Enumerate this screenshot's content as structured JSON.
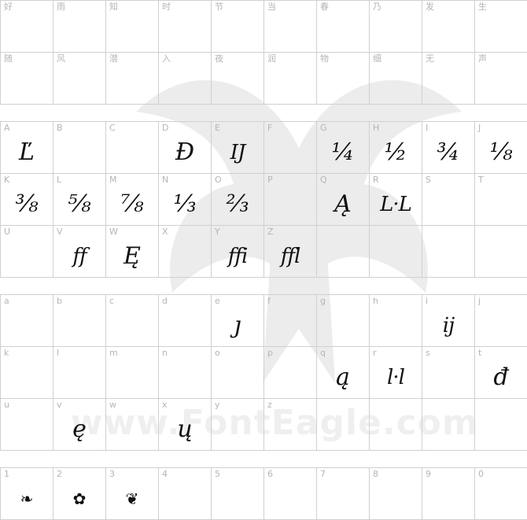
{
  "sections": [
    {
      "name": "cjk",
      "rows": [
        [
          {
            "label": "好",
            "glyph": ""
          },
          {
            "label": "雨",
            "glyph": ""
          },
          {
            "label": "知",
            "glyph": ""
          },
          {
            "label": "时",
            "glyph": ""
          },
          {
            "label": "节",
            "glyph": ""
          },
          {
            "label": "当",
            "glyph": ""
          },
          {
            "label": "春",
            "glyph": ""
          },
          {
            "label": "乃",
            "glyph": ""
          },
          {
            "label": "发",
            "glyph": ""
          },
          {
            "label": "生",
            "glyph": ""
          }
        ],
        [
          {
            "label": "随",
            "glyph": ""
          },
          {
            "label": "风",
            "glyph": ""
          },
          {
            "label": "潜",
            "glyph": ""
          },
          {
            "label": "入",
            "glyph": ""
          },
          {
            "label": "夜",
            "glyph": ""
          },
          {
            "label": "润",
            "glyph": ""
          },
          {
            "label": "物",
            "glyph": ""
          },
          {
            "label": "细",
            "glyph": ""
          },
          {
            "label": "无",
            "glyph": ""
          },
          {
            "label": "声",
            "glyph": ""
          }
        ]
      ]
    },
    {
      "name": "uppercase",
      "rows": [
        [
          {
            "label": "A",
            "glyph": "Ľ"
          },
          {
            "label": "B",
            "glyph": ""
          },
          {
            "label": "C",
            "glyph": ""
          },
          {
            "label": "D",
            "glyph": "Đ"
          },
          {
            "label": "E",
            "glyph": "IJ"
          },
          {
            "label": "F",
            "glyph": ""
          },
          {
            "label": "G",
            "glyph": "¼"
          },
          {
            "label": "H",
            "glyph": "½"
          },
          {
            "label": "I",
            "glyph": "¾"
          },
          {
            "label": "J",
            "glyph": "⅛"
          }
        ],
        [
          {
            "label": "K",
            "glyph": "⅜"
          },
          {
            "label": "L",
            "glyph": "⅝"
          },
          {
            "label": "M",
            "glyph": "⅞"
          },
          {
            "label": "N",
            "glyph": "⅓"
          },
          {
            "label": "O",
            "glyph": "⅔"
          },
          {
            "label": "P",
            "glyph": ""
          },
          {
            "label": "Q",
            "glyph": "Ą"
          },
          {
            "label": "R",
            "glyph": "L·L"
          },
          {
            "label": "S",
            "glyph": ""
          },
          {
            "label": "T",
            "glyph": ""
          }
        ],
        [
          {
            "label": "U",
            "glyph": ""
          },
          {
            "label": "V",
            "glyph": "ff"
          },
          {
            "label": "W",
            "glyph": "Ę"
          },
          {
            "label": "X",
            "glyph": ""
          },
          {
            "label": "Y",
            "glyph": "ffi"
          },
          {
            "label": "Z",
            "glyph": "ffl"
          },
          {
            "label": "",
            "glyph": "-"
          },
          {
            "label": "",
            "glyph": "-"
          },
          {
            "label": "",
            "glyph": "-"
          },
          {
            "label": "",
            "glyph": "-"
          }
        ]
      ]
    },
    {
      "name": "lowercase",
      "rows": [
        [
          {
            "label": "a",
            "glyph": ""
          },
          {
            "label": "b",
            "glyph": ""
          },
          {
            "label": "c",
            "glyph": ""
          },
          {
            "label": "d",
            "glyph": ""
          },
          {
            "label": "e",
            "glyph": "ȷ"
          },
          {
            "label": "f",
            "glyph": ""
          },
          {
            "label": "g",
            "glyph": ""
          },
          {
            "label": "h",
            "glyph": ""
          },
          {
            "label": "i",
            "glyph": "ij"
          },
          {
            "label": "j",
            "glyph": ""
          }
        ],
        [
          {
            "label": "k",
            "glyph": ""
          },
          {
            "label": "l",
            "glyph": ""
          },
          {
            "label": "m",
            "glyph": ""
          },
          {
            "label": "n",
            "glyph": ""
          },
          {
            "label": "o",
            "glyph": ""
          },
          {
            "label": "p",
            "glyph": ""
          },
          {
            "label": "q",
            "glyph": "ą"
          },
          {
            "label": "r",
            "glyph": "l·l"
          },
          {
            "label": "s",
            "glyph": ""
          },
          {
            "label": "t",
            "glyph": "đ"
          }
        ],
        [
          {
            "label": "u",
            "glyph": ""
          },
          {
            "label": "v",
            "glyph": "ę"
          },
          {
            "label": "w",
            "glyph": ""
          },
          {
            "label": "x",
            "glyph": "ų"
          },
          {
            "label": "y",
            "glyph": ""
          },
          {
            "label": "z",
            "glyph": ""
          },
          {
            "label": "",
            "glyph": "-"
          },
          {
            "label": "",
            "glyph": "-"
          },
          {
            "label": "",
            "glyph": "-"
          },
          {
            "label": "",
            "glyph": "-"
          }
        ]
      ]
    },
    {
      "name": "digits",
      "rows": [
        [
          {
            "label": "1",
            "glyph": "❧"
          },
          {
            "label": "2",
            "glyph": "✿"
          },
          {
            "label": "3",
            "glyph": "❦"
          },
          {
            "label": "4",
            "glyph": ""
          },
          {
            "label": "5",
            "glyph": ""
          },
          {
            "label": "6",
            "glyph": ""
          },
          {
            "label": "7",
            "glyph": ""
          },
          {
            "label": "8",
            "glyph": ""
          },
          {
            "label": "9",
            "glyph": ""
          },
          {
            "label": "0",
            "glyph": ""
          }
        ]
      ]
    }
  ],
  "watermark": "www.FontEagle.com"
}
